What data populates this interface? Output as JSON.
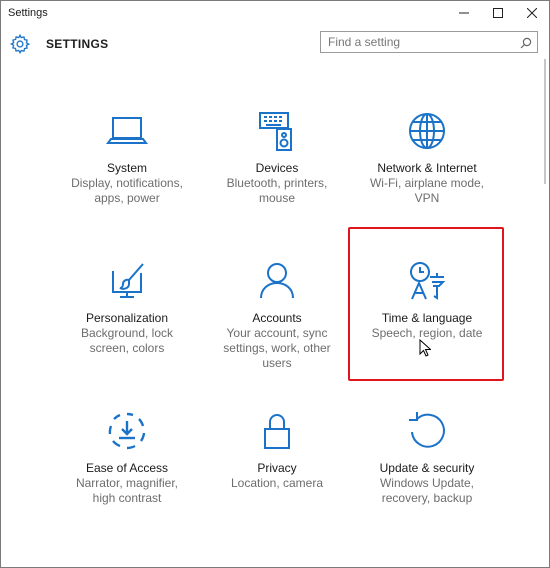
{
  "window": {
    "title": "Settings",
    "controls": {
      "minimize": "–",
      "maximize": "☐",
      "close": "✕"
    }
  },
  "header": {
    "title": "SETTINGS",
    "search_placeholder": "Find a setting",
    "search_value": ""
  },
  "accent_color": "#1a73c8",
  "highlight_color": "#e0141c",
  "tiles": [
    {
      "id": "system",
      "icon": "laptop-icon",
      "name": "System",
      "desc": [
        "Display, notifications,",
        "apps, power"
      ]
    },
    {
      "id": "devices",
      "icon": "keyboard-speaker-icon",
      "name": "Devices",
      "desc": [
        "Bluetooth, printers,",
        "mouse"
      ]
    },
    {
      "id": "network",
      "icon": "globe-icon",
      "name": "Network & Internet",
      "desc": [
        "Wi-Fi, airplane mode,",
        "VPN"
      ]
    },
    {
      "id": "personalization",
      "icon": "paintbrush-monitor-icon",
      "name": "Personalization",
      "desc": [
        "Background, lock",
        "screen, colors"
      ]
    },
    {
      "id": "accounts",
      "icon": "person-icon",
      "name": "Accounts",
      "desc": [
        "Your account, sync",
        "settings, work, other",
        "users"
      ]
    },
    {
      "id": "time-language",
      "icon": "clock-language-icon",
      "name": "Time & language",
      "desc": [
        "Speech, region, date"
      ]
    },
    {
      "id": "ease-of-access",
      "icon": "ease-of-access-icon",
      "name": "Ease of Access",
      "desc": [
        "Narrator, magnifier,",
        "high contrast"
      ]
    },
    {
      "id": "privacy",
      "icon": "lock-icon",
      "name": "Privacy",
      "desc": [
        "Location, camera"
      ]
    },
    {
      "id": "update-security",
      "icon": "refresh-icon",
      "name": "Update & security",
      "desc": [
        "Windows Update,",
        "recovery, backup"
      ]
    }
  ]
}
